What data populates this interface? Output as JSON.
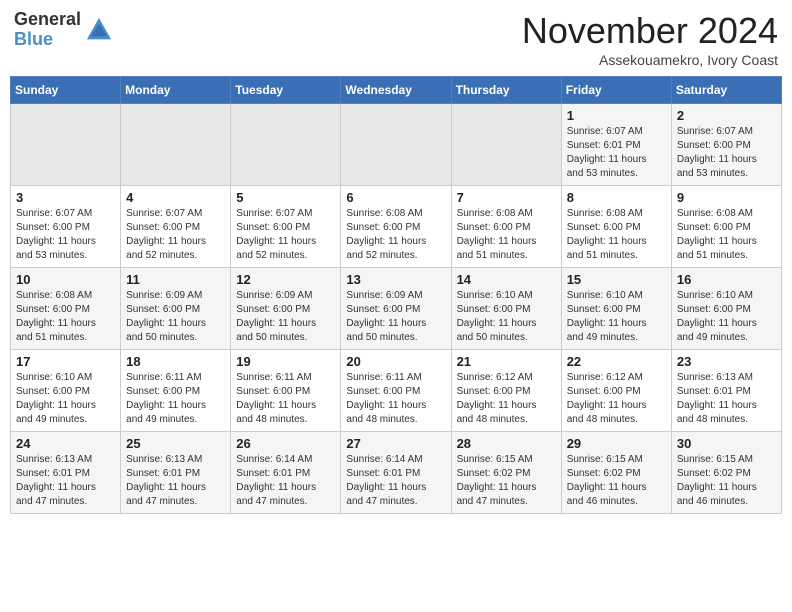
{
  "header": {
    "logo_general": "General",
    "logo_blue": "Blue",
    "title": "November 2024",
    "subtitle": "Assekouamekro, Ivory Coast"
  },
  "weekdays": [
    "Sunday",
    "Monday",
    "Tuesday",
    "Wednesday",
    "Thursday",
    "Friday",
    "Saturday"
  ],
  "weeks": [
    [
      {
        "day": "",
        "empty": true
      },
      {
        "day": "",
        "empty": true
      },
      {
        "day": "",
        "empty": true
      },
      {
        "day": "",
        "empty": true
      },
      {
        "day": "",
        "empty": true
      },
      {
        "day": "1",
        "sunrise": "Sunrise: 6:07 AM",
        "sunset": "Sunset: 6:01 PM",
        "daylight": "Daylight: 11 hours and 53 minutes."
      },
      {
        "day": "2",
        "sunrise": "Sunrise: 6:07 AM",
        "sunset": "Sunset: 6:00 PM",
        "daylight": "Daylight: 11 hours and 53 minutes."
      }
    ],
    [
      {
        "day": "3",
        "sunrise": "Sunrise: 6:07 AM",
        "sunset": "Sunset: 6:00 PM",
        "daylight": "Daylight: 11 hours and 53 minutes."
      },
      {
        "day": "4",
        "sunrise": "Sunrise: 6:07 AM",
        "sunset": "Sunset: 6:00 PM",
        "daylight": "Daylight: 11 hours and 52 minutes."
      },
      {
        "day": "5",
        "sunrise": "Sunrise: 6:07 AM",
        "sunset": "Sunset: 6:00 PM",
        "daylight": "Daylight: 11 hours and 52 minutes."
      },
      {
        "day": "6",
        "sunrise": "Sunrise: 6:08 AM",
        "sunset": "Sunset: 6:00 PM",
        "daylight": "Daylight: 11 hours and 52 minutes."
      },
      {
        "day": "7",
        "sunrise": "Sunrise: 6:08 AM",
        "sunset": "Sunset: 6:00 PM",
        "daylight": "Daylight: 11 hours and 51 minutes."
      },
      {
        "day": "8",
        "sunrise": "Sunrise: 6:08 AM",
        "sunset": "Sunset: 6:00 PM",
        "daylight": "Daylight: 11 hours and 51 minutes."
      },
      {
        "day": "9",
        "sunrise": "Sunrise: 6:08 AM",
        "sunset": "Sunset: 6:00 PM",
        "daylight": "Daylight: 11 hours and 51 minutes."
      }
    ],
    [
      {
        "day": "10",
        "sunrise": "Sunrise: 6:08 AM",
        "sunset": "Sunset: 6:00 PM",
        "daylight": "Daylight: 11 hours and 51 minutes."
      },
      {
        "day": "11",
        "sunrise": "Sunrise: 6:09 AM",
        "sunset": "Sunset: 6:00 PM",
        "daylight": "Daylight: 11 hours and 50 minutes."
      },
      {
        "day": "12",
        "sunrise": "Sunrise: 6:09 AM",
        "sunset": "Sunset: 6:00 PM",
        "daylight": "Daylight: 11 hours and 50 minutes."
      },
      {
        "day": "13",
        "sunrise": "Sunrise: 6:09 AM",
        "sunset": "Sunset: 6:00 PM",
        "daylight": "Daylight: 11 hours and 50 minutes."
      },
      {
        "day": "14",
        "sunrise": "Sunrise: 6:10 AM",
        "sunset": "Sunset: 6:00 PM",
        "daylight": "Daylight: 11 hours and 50 minutes."
      },
      {
        "day": "15",
        "sunrise": "Sunrise: 6:10 AM",
        "sunset": "Sunset: 6:00 PM",
        "daylight": "Daylight: 11 hours and 49 minutes."
      },
      {
        "day": "16",
        "sunrise": "Sunrise: 6:10 AM",
        "sunset": "Sunset: 6:00 PM",
        "daylight": "Daylight: 11 hours and 49 minutes."
      }
    ],
    [
      {
        "day": "17",
        "sunrise": "Sunrise: 6:10 AM",
        "sunset": "Sunset: 6:00 PM",
        "daylight": "Daylight: 11 hours and 49 minutes."
      },
      {
        "day": "18",
        "sunrise": "Sunrise: 6:11 AM",
        "sunset": "Sunset: 6:00 PM",
        "daylight": "Daylight: 11 hours and 49 minutes."
      },
      {
        "day": "19",
        "sunrise": "Sunrise: 6:11 AM",
        "sunset": "Sunset: 6:00 PM",
        "daylight": "Daylight: 11 hours and 48 minutes."
      },
      {
        "day": "20",
        "sunrise": "Sunrise: 6:11 AM",
        "sunset": "Sunset: 6:00 PM",
        "daylight": "Daylight: 11 hours and 48 minutes."
      },
      {
        "day": "21",
        "sunrise": "Sunrise: 6:12 AM",
        "sunset": "Sunset: 6:00 PM",
        "daylight": "Daylight: 11 hours and 48 minutes."
      },
      {
        "day": "22",
        "sunrise": "Sunrise: 6:12 AM",
        "sunset": "Sunset: 6:00 PM",
        "daylight": "Daylight: 11 hours and 48 minutes."
      },
      {
        "day": "23",
        "sunrise": "Sunrise: 6:13 AM",
        "sunset": "Sunset: 6:01 PM",
        "daylight": "Daylight: 11 hours and 48 minutes."
      }
    ],
    [
      {
        "day": "24",
        "sunrise": "Sunrise: 6:13 AM",
        "sunset": "Sunset: 6:01 PM",
        "daylight": "Daylight: 11 hours and 47 minutes."
      },
      {
        "day": "25",
        "sunrise": "Sunrise: 6:13 AM",
        "sunset": "Sunset: 6:01 PM",
        "daylight": "Daylight: 11 hours and 47 minutes."
      },
      {
        "day": "26",
        "sunrise": "Sunrise: 6:14 AM",
        "sunset": "Sunset: 6:01 PM",
        "daylight": "Daylight: 11 hours and 47 minutes."
      },
      {
        "day": "27",
        "sunrise": "Sunrise: 6:14 AM",
        "sunset": "Sunset: 6:01 PM",
        "daylight": "Daylight: 11 hours and 47 minutes."
      },
      {
        "day": "28",
        "sunrise": "Sunrise: 6:15 AM",
        "sunset": "Sunset: 6:02 PM",
        "daylight": "Daylight: 11 hours and 47 minutes."
      },
      {
        "day": "29",
        "sunrise": "Sunrise: 6:15 AM",
        "sunset": "Sunset: 6:02 PM",
        "daylight": "Daylight: 11 hours and 46 minutes."
      },
      {
        "day": "30",
        "sunrise": "Sunrise: 6:15 AM",
        "sunset": "Sunset: 6:02 PM",
        "daylight": "Daylight: 11 hours and 46 minutes."
      }
    ]
  ]
}
